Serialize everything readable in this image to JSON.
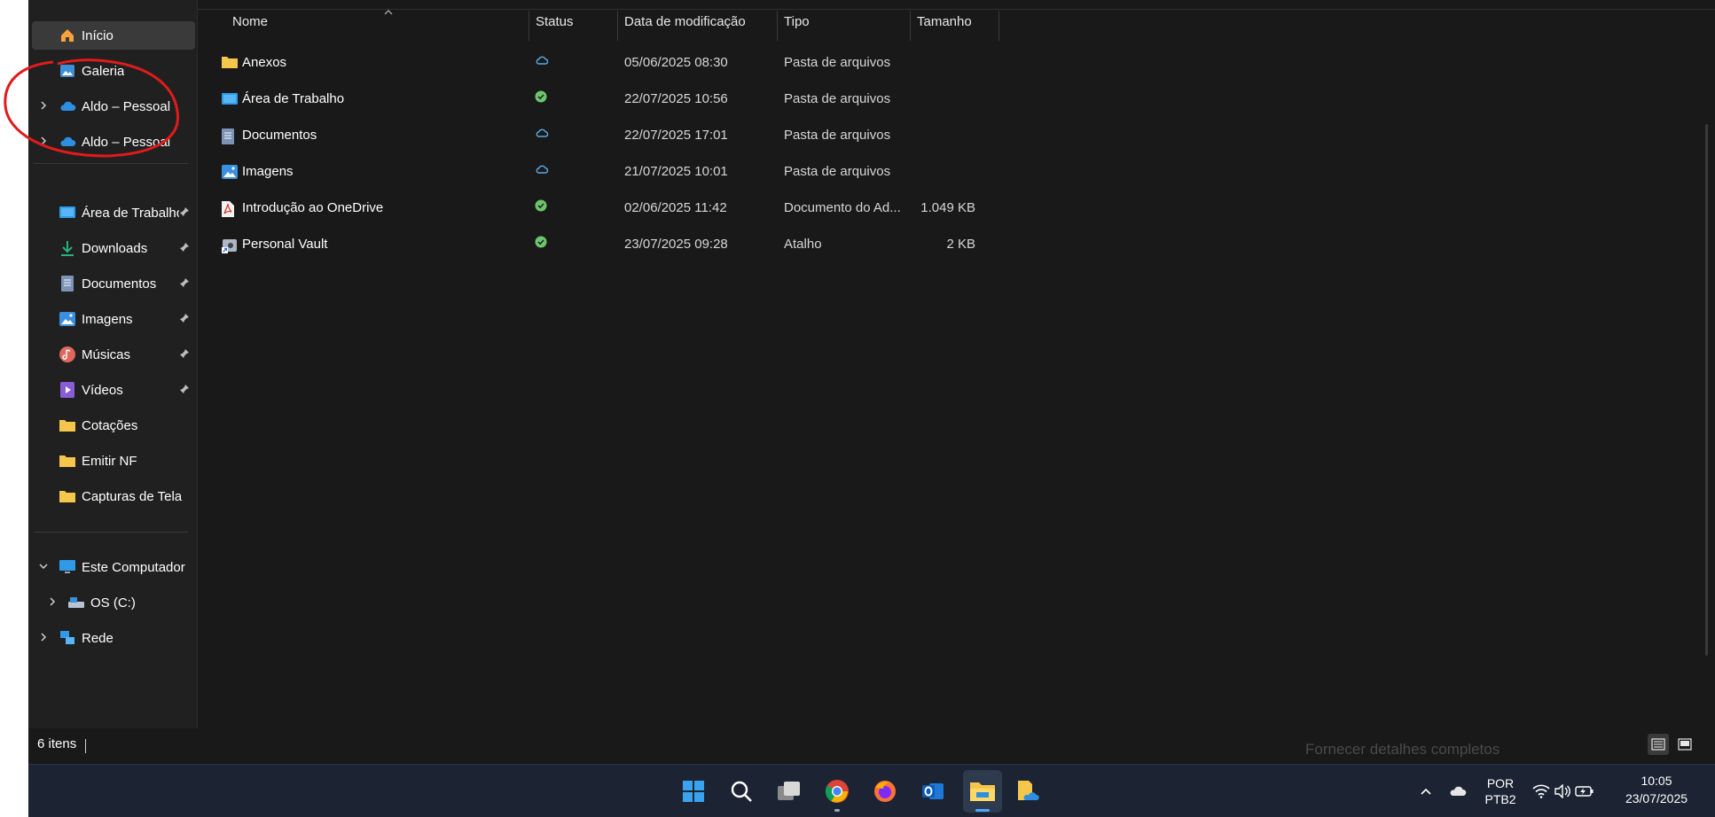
{
  "sidebar": {
    "items": [
      {
        "label": "Início",
        "icon": "home-icon"
      },
      {
        "label": "Galeria",
        "icon": "gallery-icon"
      },
      {
        "label": "Aldo – Pessoal",
        "icon": "onedrive-cloud-icon"
      },
      {
        "label": "Aldo – Pessoal",
        "icon": "onedrive-cloud-icon"
      },
      {
        "label": "Área de Trabalho",
        "icon": "desktop-icon"
      },
      {
        "label": "Downloads",
        "icon": "download-icon"
      },
      {
        "label": "Documentos",
        "icon": "document-icon"
      },
      {
        "label": "Imagens",
        "icon": "pictures-icon"
      },
      {
        "label": "Músicas",
        "icon": "music-icon"
      },
      {
        "label": "Vídeos",
        "icon": "video-icon"
      },
      {
        "label": "Cotações",
        "icon": "folder-icon"
      },
      {
        "label": "Emitir NF",
        "icon": "folder-icon"
      },
      {
        "label": "Capturas de Tela",
        "icon": "folder-icon"
      },
      {
        "label": "Este Computador",
        "icon": "computer-icon"
      },
      {
        "label": "OS (C:)",
        "icon": "drive-icon"
      },
      {
        "label": "Rede",
        "icon": "network-icon"
      }
    ]
  },
  "columns": {
    "name": "Nome",
    "status": "Status",
    "date": "Data de modificação",
    "type": "Tipo",
    "size": "Tamanho"
  },
  "files": [
    {
      "name": "Anexos",
      "status": "cloud",
      "date": "05/06/2025 08:30",
      "type": "Pasta de arquivos",
      "size": "",
      "icon": "folder-icon"
    },
    {
      "name": "Área de Trabalho",
      "status": "synced",
      "date": "22/07/2025 10:56",
      "type": "Pasta de arquivos",
      "size": "",
      "icon": "desktop-icon"
    },
    {
      "name": "Documentos",
      "status": "cloud",
      "date": "22/07/2025 17:01",
      "type": "Pasta de arquivos",
      "size": "",
      "icon": "document-icon"
    },
    {
      "name": "Imagens",
      "status": "cloud",
      "date": "21/07/2025 10:01",
      "type": "Pasta de arquivos",
      "size": "",
      "icon": "pictures-icon"
    },
    {
      "name": "Introdução ao OneDrive",
      "status": "synced",
      "date": "02/06/2025 11:42",
      "type": "Documento do Ad...",
      "size": "1.049 KB",
      "icon": "pdf-icon"
    },
    {
      "name": "Personal Vault",
      "status": "synced",
      "date": "23/07/2025 09:28",
      "type": "Atalho",
      "size": "2 KB",
      "icon": "vault-shortcut-icon"
    }
  ],
  "statusbar": {
    "count": "6 itens"
  },
  "behind_window_text": "Fornecer detalhes completos",
  "tray": {
    "lang_line1": "POR",
    "lang_line2": "PTB2",
    "time": "10:05",
    "date": "23/07/2025"
  },
  "colors": {
    "background": "#191919",
    "sidebar": "#202020",
    "taskbar": "#1c2433",
    "annotation": "#e01b1b",
    "synced": "#6cc56c",
    "cloud": "#5aa9e6",
    "folder": "#f4c64b"
  }
}
